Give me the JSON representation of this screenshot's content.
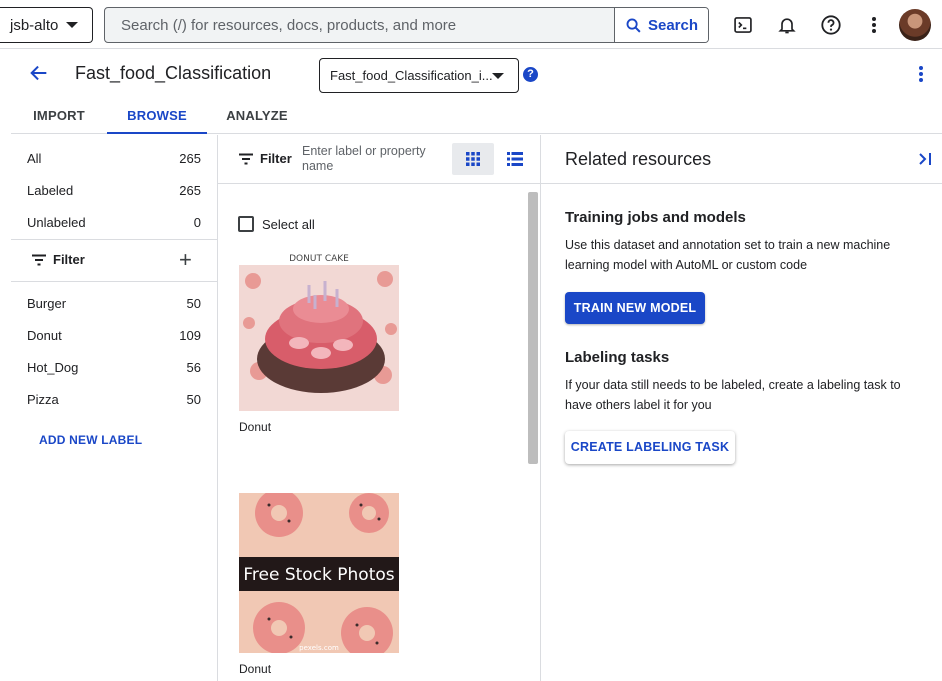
{
  "topbar": {
    "project": "jsb-alto",
    "search_placeholder": "Search (/) for resources, docs, products, and more",
    "search_button": "Search"
  },
  "page": {
    "title": "Fast_food_Classification",
    "dataset_select": "Fast_food_Classification_i..."
  },
  "tabs": [
    "IMPORT",
    "BROWSE",
    "ANALYZE"
  ],
  "active_tab": "BROWSE",
  "left_panel": {
    "counts": [
      {
        "label": "All",
        "count": "265"
      },
      {
        "label": "Labeled",
        "count": "265"
      },
      {
        "label": "Unlabeled",
        "count": "0"
      }
    ],
    "filter_label": "Filter",
    "labels": [
      {
        "label": "Burger",
        "count": "50"
      },
      {
        "label": "Donut",
        "count": "109"
      },
      {
        "label": "Hot_Dog",
        "count": "56"
      },
      {
        "label": "Pizza",
        "count": "50"
      }
    ],
    "add_label": "ADD NEW LABEL"
  },
  "browse": {
    "filter_label": "Filter",
    "filter_placeholder": "Enter label or property name",
    "select_all": "Select all",
    "items": [
      {
        "caption": "Donut",
        "image_text": "DONUT CAKE"
      },
      {
        "caption": "Donut",
        "image_text": "Free Stock Photos",
        "image_subtext": "pexels.com"
      }
    ]
  },
  "related": {
    "title": "Related resources",
    "training_title": "Training jobs and models",
    "training_desc": "Use this dataset and annotation set to train a new machine learning model with AutoML or custom code",
    "train_button": "TRAIN NEW MODEL",
    "labeling_title": "Labeling tasks",
    "labeling_desc": "If your data still needs to be labeled, create a labeling task to have others label it for you",
    "labeling_button": "CREATE LABELING TASK"
  },
  "colors": {
    "accent": "#1a47c7",
    "border": "#dadce0"
  }
}
